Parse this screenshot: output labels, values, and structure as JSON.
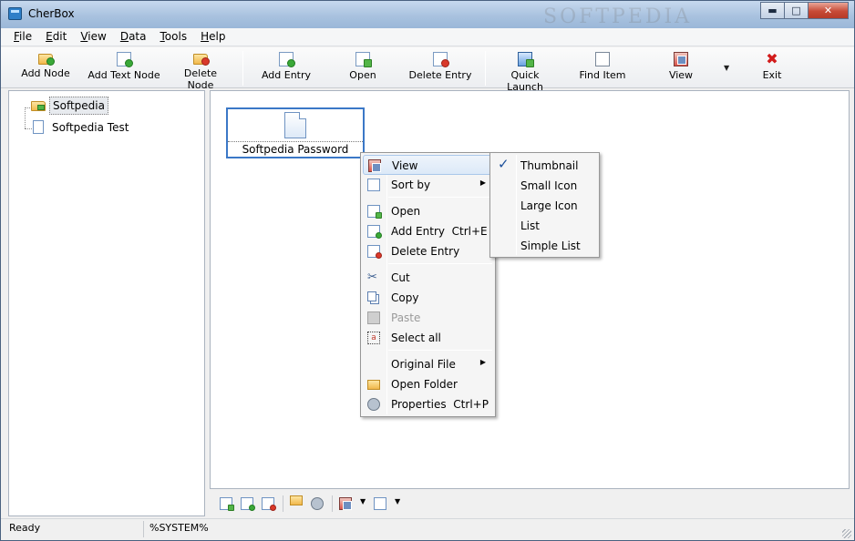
{
  "window": {
    "title": "CherBox",
    "controls": {
      "minimize": "▬",
      "maximize": "□",
      "close": "✕"
    },
    "watermark": "SOFTPEDIA"
  },
  "menubar": [
    {
      "label": "File",
      "key": "F",
      "rest": "ile"
    },
    {
      "label": "Edit",
      "key": "E",
      "rest": "dit"
    },
    {
      "label": "View",
      "key": "V",
      "rest": "iew"
    },
    {
      "label": "Data",
      "key": "D",
      "rest": "ata"
    },
    {
      "label": "Tools",
      "key": "T",
      "rest": "ools"
    },
    {
      "label": "Help",
      "key": "H",
      "rest": "elp"
    }
  ],
  "toolbar": {
    "add_node": "Add Node",
    "add_text_node": "Add Text Node",
    "delete_node": "Delete Node",
    "add_entry": "Add Entry",
    "open": "Open",
    "delete_entry": "Delete Entry",
    "quick_launch": "Quick Launch",
    "find_item": "Find Item",
    "view": "View",
    "view_dropdown": "▼",
    "exit": "Exit",
    "exit_glyph": "✖"
  },
  "tree": {
    "nodes": [
      {
        "label": "Softpedia",
        "icon": "folder-icon",
        "selected": true
      },
      {
        "label": "Softpedia Test",
        "icon": "document-icon",
        "selected": false
      }
    ]
  },
  "content": {
    "items": [
      {
        "label": "Softpedia Password",
        "icon": "document-icon",
        "selected": true
      }
    ]
  },
  "context_menu": {
    "view": "View",
    "sort_by": "Sort by",
    "open": "Open",
    "add_entry": "Add Entry",
    "add_entry_shortcut": "Ctrl+E",
    "delete_entry": "Delete Entry",
    "cut": "Cut",
    "copy": "Copy",
    "paste": "Paste",
    "select_all": "Select all",
    "original_file": "Original File",
    "open_folder": "Open Folder",
    "properties": "Properties",
    "properties_shortcut": "Ctrl+P",
    "submenu_arrow": "▶"
  },
  "view_submenu": {
    "checked": "Thumbnail",
    "check_glyph": "✓",
    "items": [
      "Thumbnail",
      "Small Icon",
      "Large Icon",
      "List",
      "Simple List"
    ]
  },
  "minibar": {
    "dropdown": "▼"
  },
  "status": {
    "state": "Ready",
    "user": "%SYSTEM%"
  },
  "colors": {
    "selection_border": "#3b78c7",
    "menu_highlight": "#dce9f8",
    "exit_icon": "#d21b1b"
  }
}
